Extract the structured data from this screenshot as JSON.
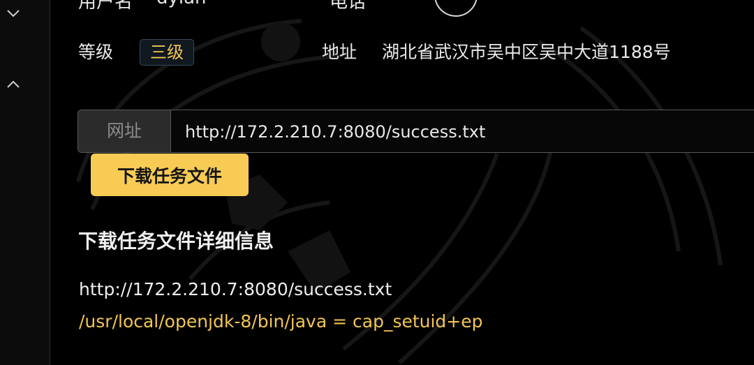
{
  "header": {
    "user_label": "用户名",
    "user_value": "dylan",
    "phone_label": "电话"
  },
  "info": {
    "level_label": "等级",
    "level_badge": "三级",
    "address_label": "地址",
    "address_value": "湖北省武汉市吴中区吴中大道1188号"
  },
  "url_form": {
    "addon_label": "网址",
    "url_value": "http://172.2.210.7:8080/success.txt",
    "download_button": "下载任务文件"
  },
  "details": {
    "title": "下载任务文件详细信息",
    "line1": "http://172.2.210.7:8080/success.txt",
    "line2": "/usr/local/openjdk-8/bin/java = cap_setuid+ep"
  },
  "colors": {
    "accent_yellow": "#f8cb55",
    "highlight_text": "#f3c553",
    "background": "#000000"
  },
  "icons": [
    "chevron-down-icon",
    "chevron-up-icon",
    "search-icon"
  ]
}
